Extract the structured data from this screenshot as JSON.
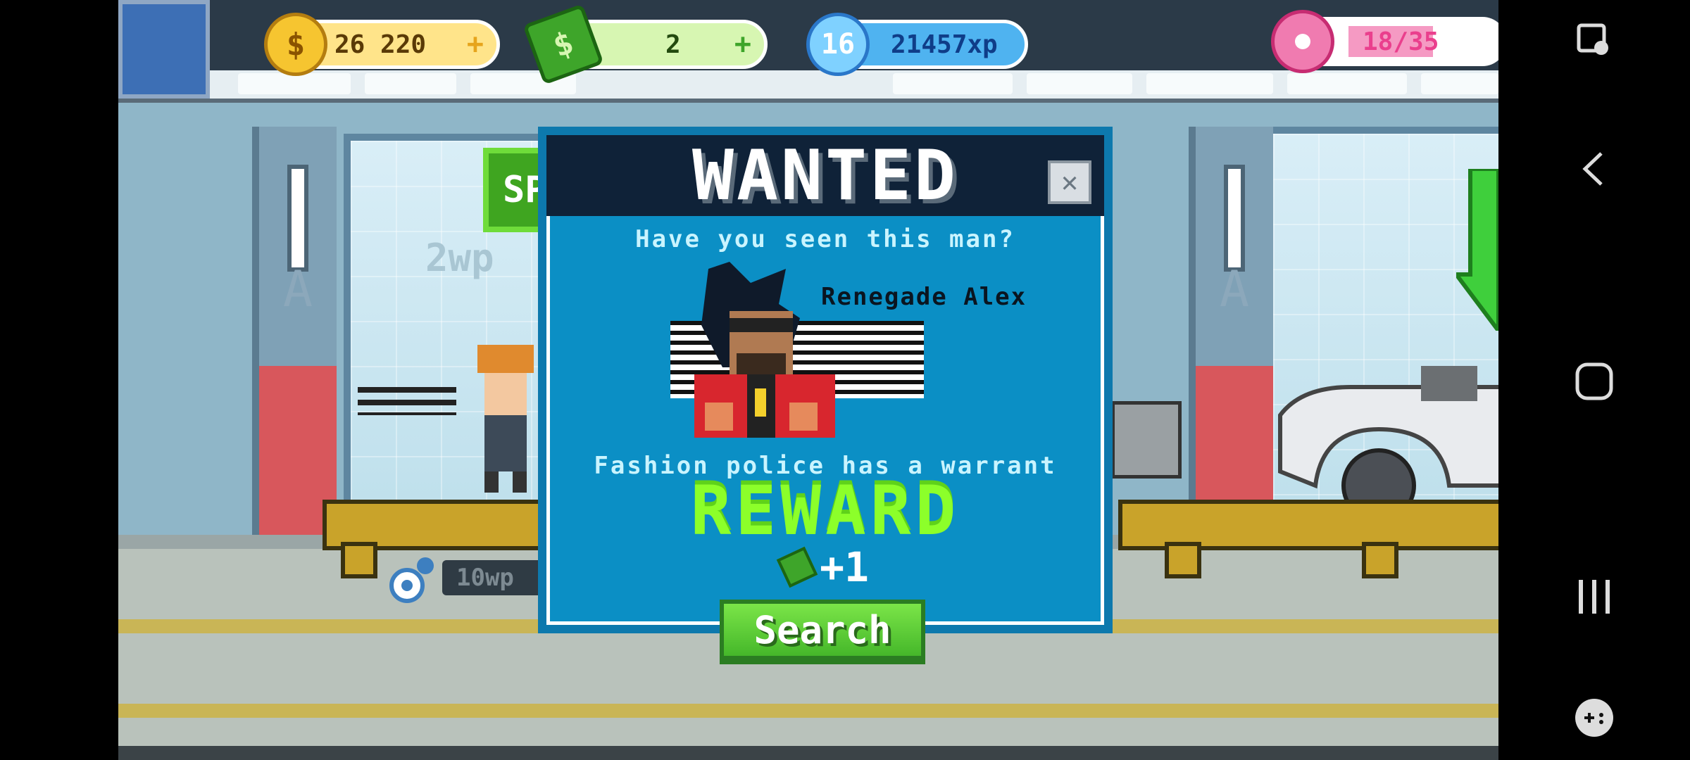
{
  "hud": {
    "coins": "26 220",
    "cash": "2",
    "level": "16",
    "xp": "21457xp",
    "donuts": "18/35"
  },
  "background": {
    "speed_sign": "SPEED",
    "wp_upper": "2wp",
    "wp_lower": "10wp"
  },
  "modal": {
    "title": "WANTED",
    "question": "Have you seen this man?",
    "name": "Renegade Alex",
    "warrant": "Fashion police has a warrant",
    "reward_label": "REWARD",
    "reward_amount": "+1",
    "search_label": "Search"
  },
  "icons": {
    "coin": "coin-icon",
    "cash": "cash-icon",
    "level": "level-star-icon",
    "donut": "donut-icon",
    "close": "close-icon",
    "gear": "gear-icon",
    "nav_screenshot": "screenshot-icon",
    "nav_back": "back-icon",
    "nav_home": "home-icon",
    "nav_recents": "recents-icon",
    "nav_game": "game-launcher-icon"
  },
  "colors": {
    "modal_bg": "#0b8fc5",
    "reward_green": "#8cff2a",
    "button_green": "#45b72a",
    "coin_gold": "#f6c530",
    "donut_pink": "#ea3f8d"
  }
}
